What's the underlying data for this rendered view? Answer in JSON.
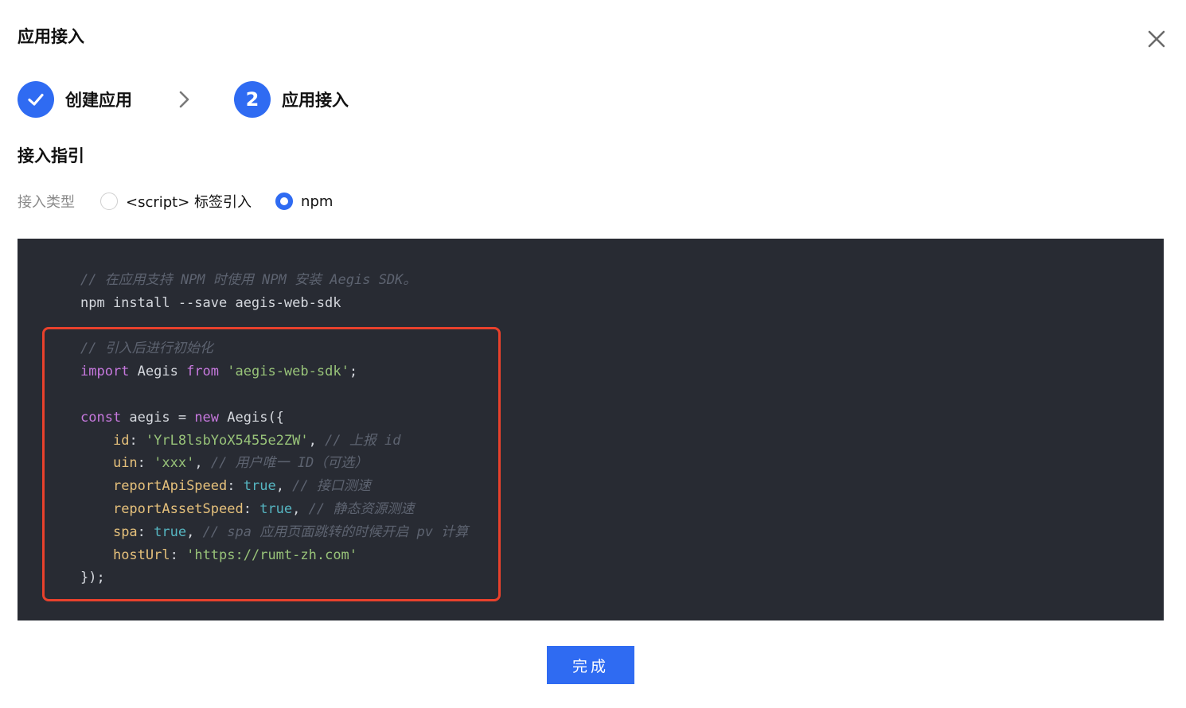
{
  "dialog": {
    "title": "应用接入",
    "close_icon": "close-icon"
  },
  "steps": [
    {
      "label": "创建应用",
      "status": "done",
      "icon": "check-icon"
    },
    {
      "label": "应用接入",
      "number": "2",
      "status": "active"
    }
  ],
  "guide": {
    "section_title": "接入指引",
    "type_label": "接入类型",
    "options": [
      {
        "label": "<script> 标签引入",
        "selected": false
      },
      {
        "label": "npm",
        "selected": true
      }
    ]
  },
  "code": {
    "lines": {
      "c1": "// 在应用支持 NPM 时使用 NPM 安装 Aegis SDK。",
      "install": "npm install --save aegis-web-sdk",
      "c2": "// 引入后进行初始化",
      "import_kw": "import",
      "import_name": " Aegis ",
      "from_kw": "from",
      "import_src": "'aegis-web-sdk'",
      "import_end": ";",
      "const_kw": "const",
      "const_mid": " aegis = ",
      "new_kw": "new",
      "const_end": " Aegis({",
      "id_key": "id",
      "id_val": "'YrL8lsbYoX5455e2ZW'",
      "id_cmt": "// 上报 id",
      "uin_key": "uin",
      "uin_val": "'xxx'",
      "uin_cmt": "// 用户唯一 ID（可选）",
      "ras_key": "reportApiSpeed",
      "ras_val": "true",
      "ras_cmt": "// 接口测速",
      "rass_key": "reportAssetSpeed",
      "rass_val": "true",
      "rass_cmt": "// 静态资源测速",
      "spa_key": "spa",
      "spa_val": "true",
      "spa_cmt": "// spa 应用页面跳转的时候开启 pv 计算",
      "host_key": "hostUrl",
      "host_val": "'https://rumt-zh.com'",
      "close": "});"
    }
  },
  "footer": {
    "done_label": "完成"
  },
  "colors": {
    "accent": "#2f6bf2",
    "code_bg": "#282b33",
    "highlight_border": "#e8412c"
  }
}
